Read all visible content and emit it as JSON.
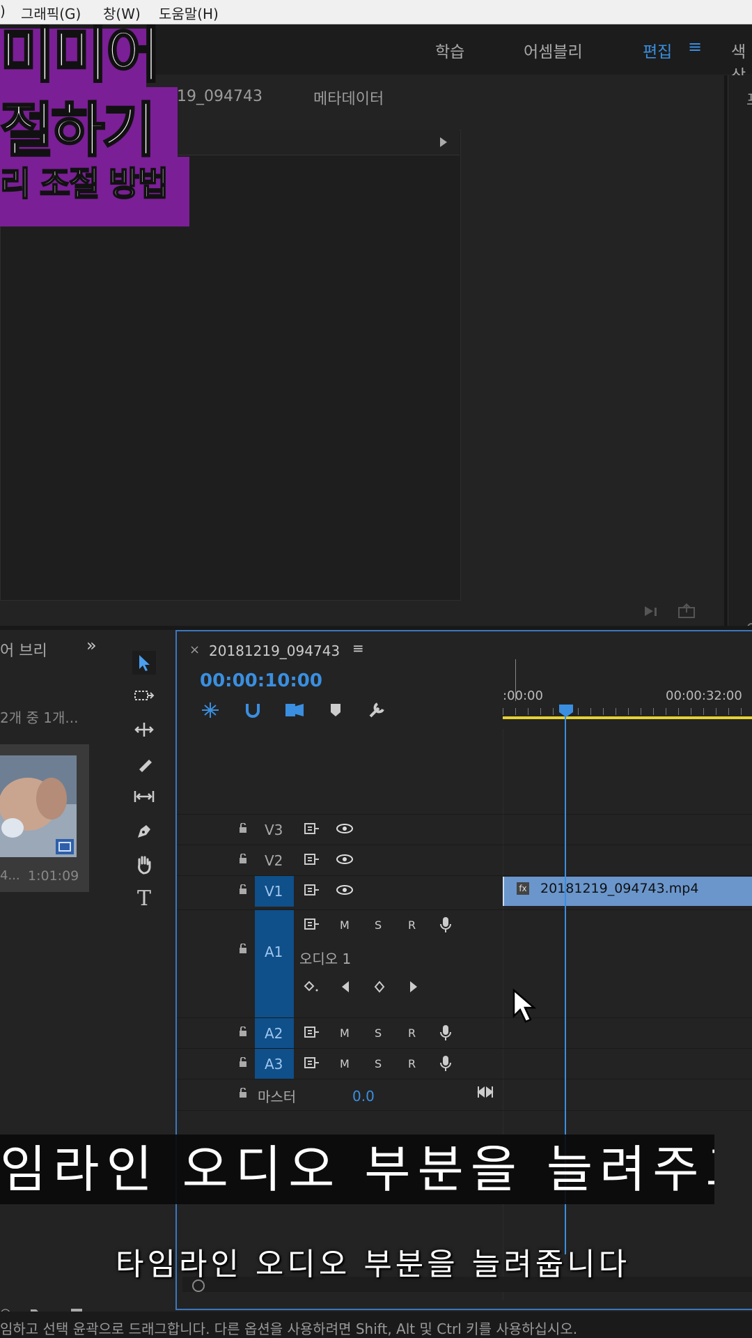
{
  "menu": {
    "partial_left": ")",
    "graphics": "그래픽(G)",
    "window": "창(W)",
    "help": "도움말(H)"
  },
  "workspaces": {
    "learn": "학습",
    "assembly": "어셈블리",
    "editing": "편집",
    "color_partial": "색상"
  },
  "overlay": {
    "line1": "미미어",
    "line2": "절하기",
    "line3": "리 조절 방법"
  },
  "source_panel": {
    "tab_clip": "81219_094743",
    "tab_metadata": "메타데이터"
  },
  "project_panel": {
    "tab_label": "어 브리",
    "selection_count": "2개 중 1개...",
    "clip_duration": "1:01:09",
    "clip_partial": "4..."
  },
  "timeline": {
    "sequence_name": "20181219_094743",
    "timecode": "00:00:10:00",
    "ruler_start": ":00:00",
    "ruler_mark": "00:00:32:00",
    "clip_name": "20181219_094743.mp4",
    "clip_fx": "fx",
    "tracks": {
      "v3": "V3",
      "v2": "V2",
      "v1": "V1",
      "a1": "A1",
      "a2": "A2",
      "a3": "A3",
      "m": "M",
      "s": "S",
      "r": "R",
      "audio1_name": "오디오 1",
      "master_label": "마스터",
      "master_value": "0.0"
    }
  },
  "captions": {
    "primary": "임라인 오디오 부분을 늘려주고,",
    "secondary": "타임라인 오디오 부분을 늘려줍니다"
  },
  "status": {
    "text": "임하고 선택 윤곽으로 드래그합니다. 다른 옵션을 사용하려면 Shift, Alt 및 Ctrl 키를 사용하십시오."
  },
  "colors": {
    "accent_blue": "#3a8fe0",
    "track_blue": "#0f4f8a",
    "clip_blue": "#6a96cc",
    "overlay_purple": "#7a1f96",
    "ruler_yellow": "#e6d234"
  }
}
